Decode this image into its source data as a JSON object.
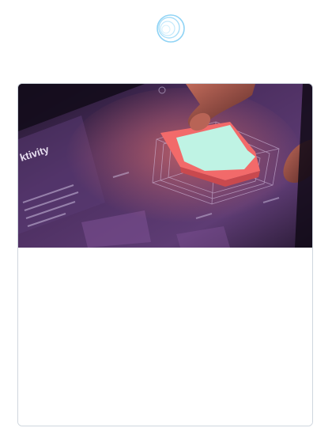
{
  "brand": {
    "logo_icon": "concentric-circles-logo-icon",
    "accent_color": "#78c8f0"
  },
  "card": {
    "image": {
      "icon": "tablet-radar-chart-illustration",
      "overlay_label": "ktivity",
      "colors": {
        "background": "#3a2448",
        "panel": "#5a3a72",
        "outer_shape": "#f26a6a",
        "inner_shape": "#bff3e4"
      }
    }
  }
}
